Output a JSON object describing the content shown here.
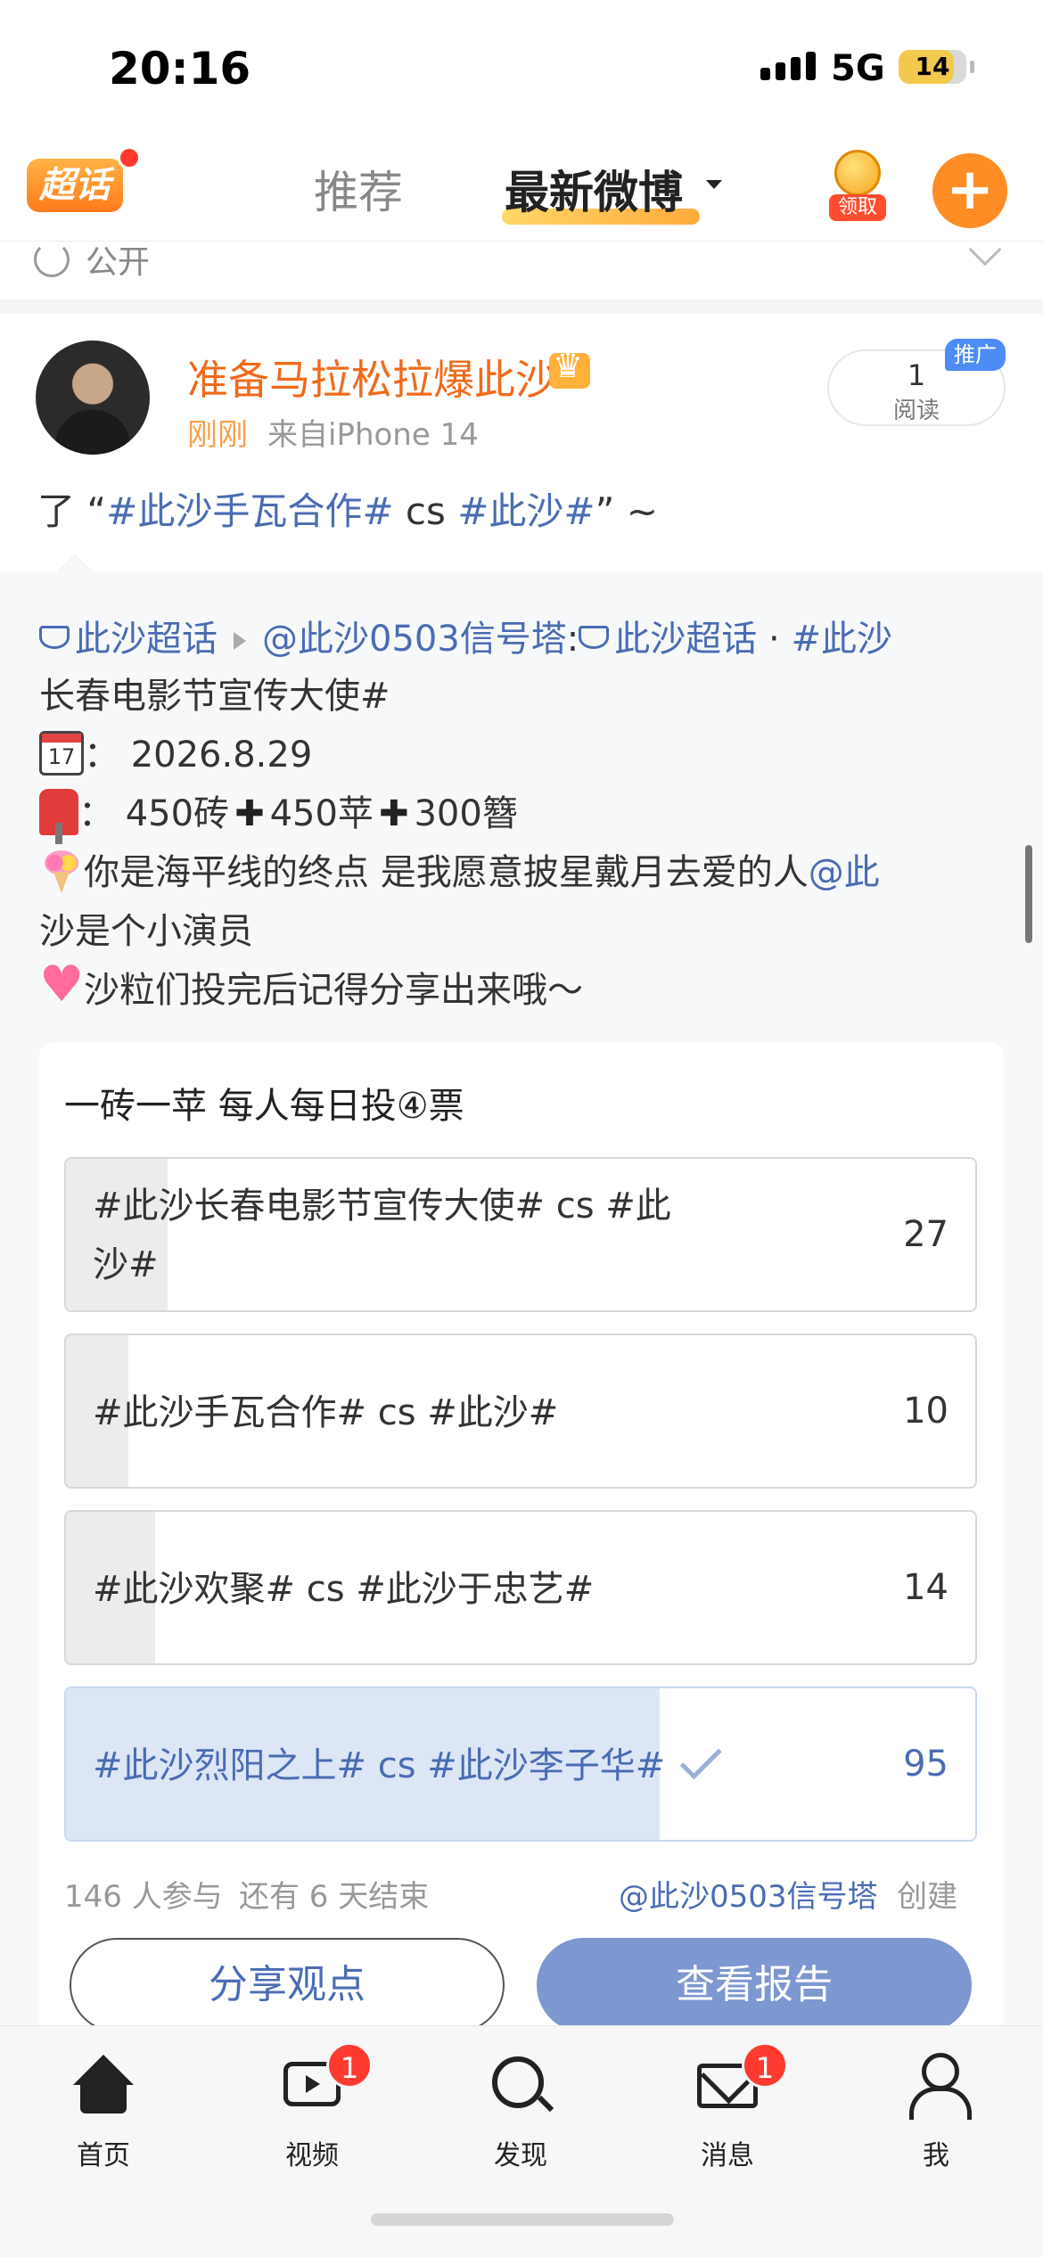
{
  "status_bar": {
    "time": "20:16",
    "network": "5G",
    "battery": "14"
  },
  "top_nav": {
    "chaohua_label": "超话",
    "tabs": [
      {
        "label": "推荐"
      },
      {
        "label": "最新微博"
      }
    ],
    "reward_label": "领取",
    "add_label": "+"
  },
  "prev_post": {
    "visibility_label": "公开"
  },
  "post": {
    "username": "准备马拉松拉爆此沙",
    "time": "刚刚",
    "source": "来自iPhone 14",
    "reads_count": "1",
    "reads_label": "阅读",
    "promo_label": "推广",
    "text_prefix": "了 “",
    "topic_1": "#此沙手瓦合作#",
    "text_mid": " cs ",
    "topic_2": "#此沙#",
    "text_suffix": "” ~"
  },
  "repost": {
    "supertopic": "此沙超话",
    "author": "@此沙0503信号塔",
    "colon": ":",
    "supertopic_2": "此沙超话",
    "dot": " · ",
    "topic_line_1": "#此沙",
    "topic_line_2": "长春电影节宣传大使#",
    "date_label": "：  2026.8.29",
    "votes_a": "：  450砖",
    "votes_b": "450苹",
    "votes_c": "300簪",
    "line_love": "你是海平线的终点 是我愿意披星戴月去爱的人",
    "mention_1": "@此",
    "mention_2": "沙是个小演员",
    "line_share": "沙粒们投完后记得分享出来哦～"
  },
  "poll": {
    "title": "一砖一苹 每人每日投④票",
    "options": [
      {
        "line1": "#此沙长春电影节宣传大使# cs #此",
        "line2": "沙#",
        "count": "27",
        "votes": 27
      },
      {
        "line1": "#此沙手瓦合作# cs #此沙#",
        "count": "10",
        "votes": 10
      },
      {
        "line1": "#此沙欢聚# cs #此沙于忠艺#",
        "count": "14",
        "votes": 14
      },
      {
        "line1": "#此沙烈阳之上# cs #此沙李子华#",
        "count": "95",
        "votes": 95,
        "selected": true
      }
    ],
    "participants": "146 人参与",
    "remaining": "还有 6 天结束",
    "creator": "@此沙0503信号塔",
    "created_label": "创建",
    "share_button": "分享观点",
    "report_button": "查看报告"
  },
  "tab_bar": {
    "items": [
      {
        "label": "首页",
        "icon": "home-icon"
      },
      {
        "label": "视频",
        "icon": "video-icon",
        "badge": "1"
      },
      {
        "label": "发现",
        "icon": "search-icon"
      },
      {
        "label": "消息",
        "icon": "mail-icon",
        "badge": "1"
      },
      {
        "label": "我",
        "icon": "user-icon"
      }
    ]
  },
  "colors": {
    "accent_orange": "#ff8c25",
    "link_blue": "#4a6cb3",
    "report_button": "#7d97d1",
    "badge_red": "#ff3b30"
  }
}
